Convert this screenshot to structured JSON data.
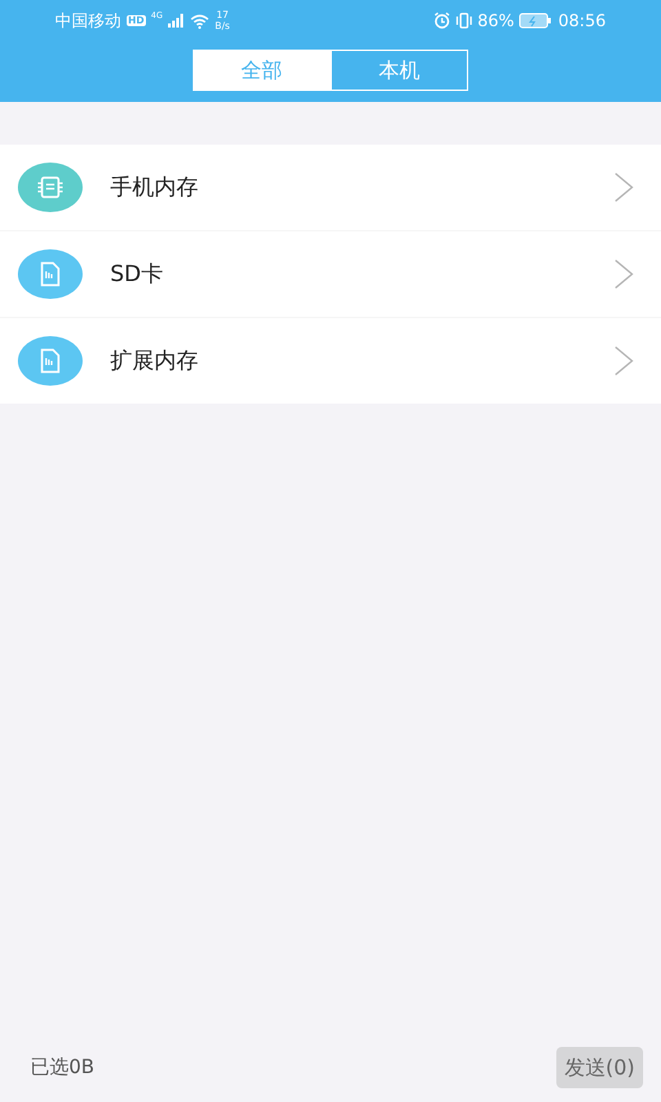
{
  "status_bar": {
    "carrier": "中国移动",
    "hd_badge": "HD",
    "network": "4G",
    "speed_value": "17",
    "speed_unit": "B/s",
    "battery_percent": "86%",
    "time": "08:56"
  },
  "tabs": [
    {
      "label": "全部",
      "selected": false
    },
    {
      "label": "本机",
      "selected": true
    }
  ],
  "storage_items": [
    {
      "label": "手机内存",
      "kind": "chip",
      "color": "#5ecdcb"
    },
    {
      "label": "SD卡",
      "kind": "card",
      "color": "#5cc6f2"
    },
    {
      "label": "扩展内存",
      "kind": "card",
      "color": "#5cc6f2"
    }
  ],
  "footer": {
    "selected_size": "已选0B",
    "send_button": "发送(0)"
  }
}
